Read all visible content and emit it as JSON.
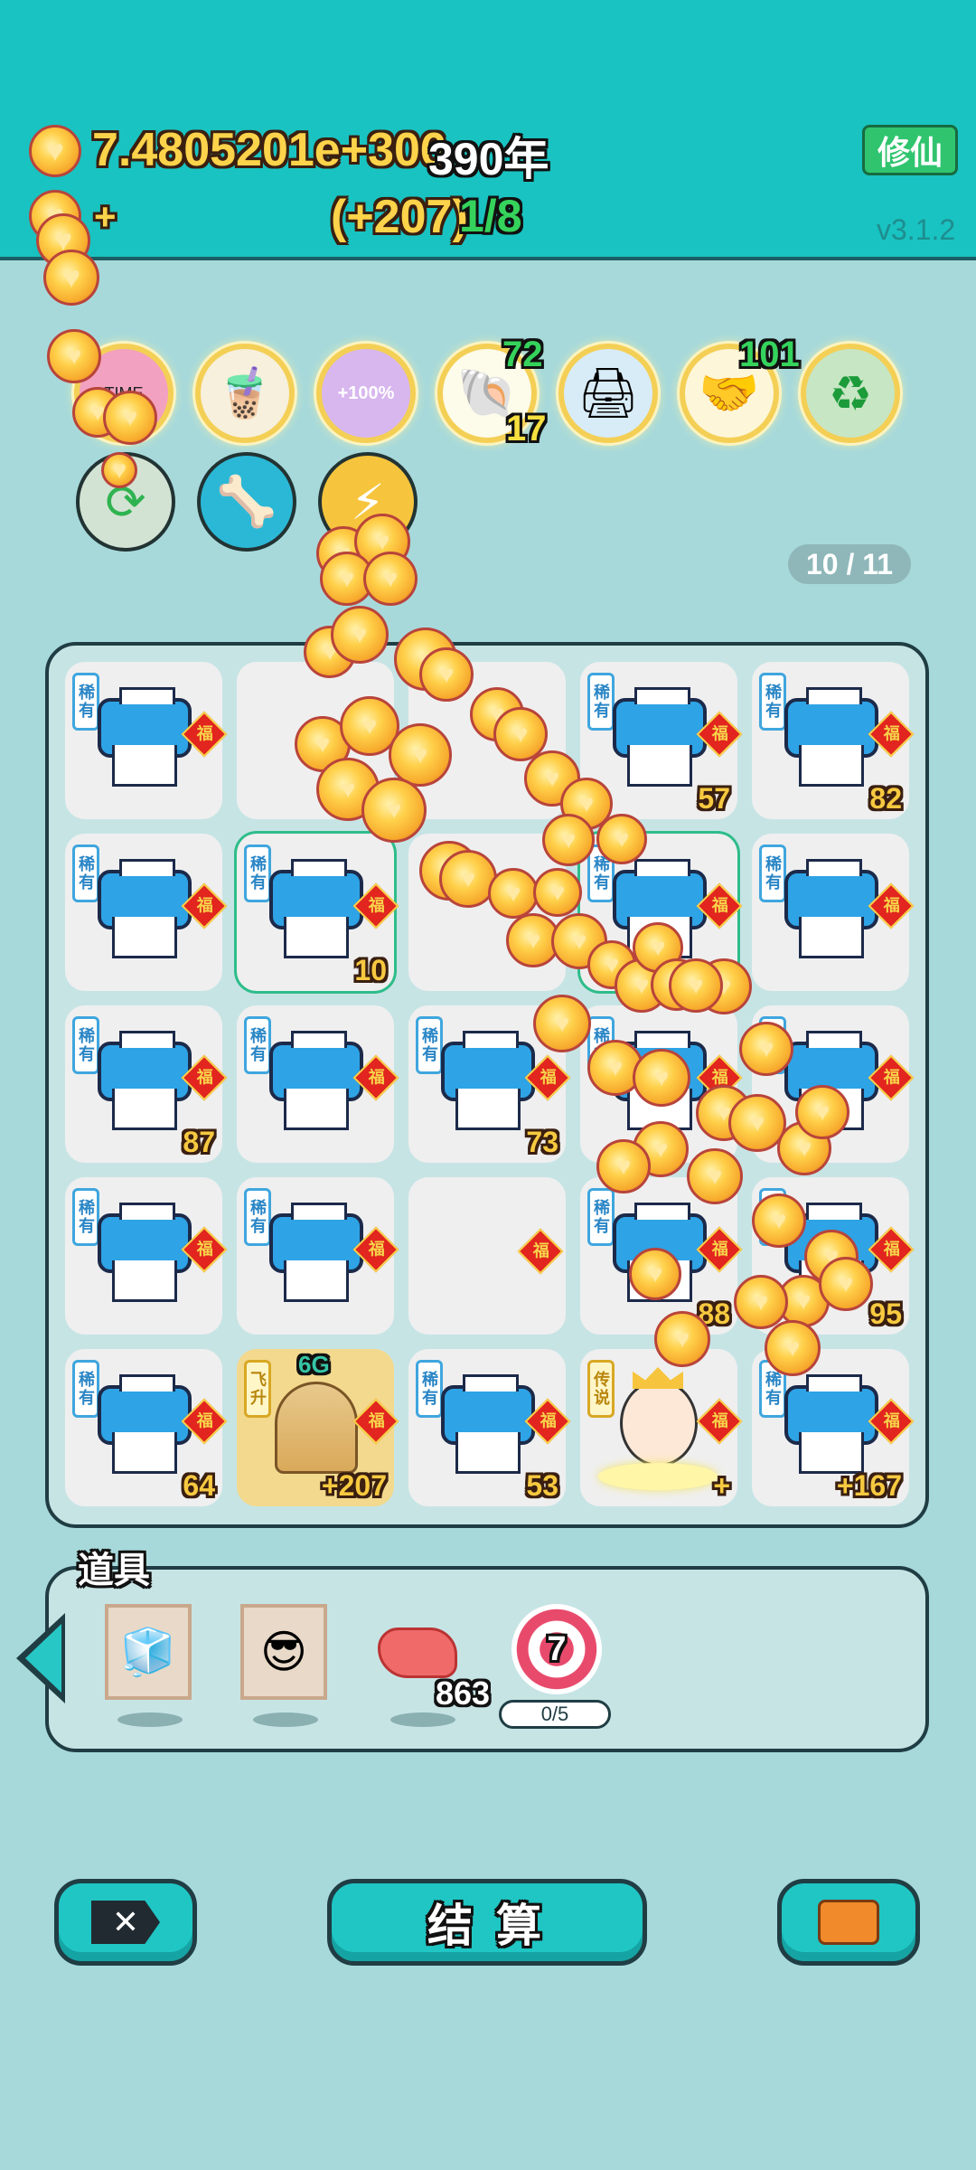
{
  "header": {
    "currency_value": "7.4805201e+306",
    "years": "390年",
    "income_plus": "+",
    "income_rate": "(+207)",
    "progress": "1/8",
    "cultivate_button": "修仙",
    "version": "v3.1.2"
  },
  "skills_row1": [
    {
      "name": "time-icon",
      "label": "TIME"
    },
    {
      "name": "milk-tea-icon"
    },
    {
      "name": "boost-icon",
      "label": "+100%"
    },
    {
      "name": "shell-icon",
      "top": "72",
      "bottom": "17"
    },
    {
      "name": "printer-alert-icon"
    },
    {
      "name": "handshake-icon",
      "top": "101"
    },
    {
      "name": "recycle-icon"
    }
  ],
  "skills_row2": [
    {
      "name": "refresh-icon"
    },
    {
      "name": "dog-food-icon"
    },
    {
      "name": "lightning-icon"
    }
  ],
  "page_indicator": "10 / 11",
  "tags": {
    "rare": "稀有",
    "legend": "传说",
    "ascend": "飞升",
    "fu": "福"
  },
  "grid": [
    [
      {
        "t": "printer",
        "n": ""
      },
      {
        "t": "empty",
        "n": ""
      },
      {
        "t": "empty",
        "n": ""
      },
      {
        "t": "printer",
        "n": "57"
      },
      {
        "t": "printer",
        "n": "82"
      }
    ],
    [
      {
        "t": "printer",
        "n": ""
      },
      {
        "t": "printer",
        "n": "10",
        "sel": true
      },
      {
        "t": "empty",
        "n": ""
      },
      {
        "t": "printer",
        "n": "",
        "sel": true
      },
      {
        "t": "printer",
        "n": ""
      }
    ],
    [
      {
        "t": "printer",
        "n": "87"
      },
      {
        "t": "printer",
        "n": ""
      },
      {
        "t": "printer",
        "n": "73"
      },
      {
        "t": "printer",
        "n": ""
      },
      {
        "t": "printer",
        "n": ""
      }
    ],
    [
      {
        "t": "printer",
        "n": ""
      },
      {
        "t": "printer",
        "n": ""
      },
      {
        "t": "fu-only",
        "n": ""
      },
      {
        "t": "printer",
        "n": "88"
      },
      {
        "t": "printer",
        "n": "95"
      }
    ],
    [
      {
        "t": "printer",
        "n": "64"
      },
      {
        "t": "tea",
        "n": "+207",
        "badge": "6G"
      },
      {
        "t": "printer",
        "n": "53"
      },
      {
        "t": "king",
        "n": "+"
      },
      {
        "t": "printer",
        "n": "+167"
      }
    ]
  ],
  "items": {
    "title": "道具",
    "meat_count": "863",
    "target_value": "7",
    "target_progress": "0/5"
  },
  "buttons": {
    "settle": "结 算"
  }
}
